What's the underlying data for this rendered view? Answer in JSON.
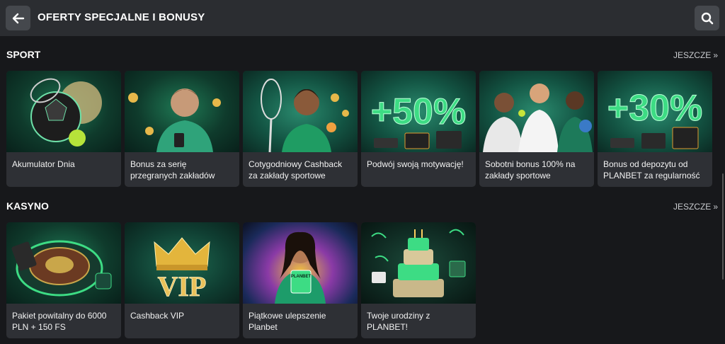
{
  "header": {
    "title": "OFERTY SPECJALNE I BONUSY"
  },
  "sections": {
    "sport": {
      "title": "SPORT",
      "more": "JESZCZE",
      "cards": [
        {
          "label": "Akumulator Dnia"
        },
        {
          "label": "Bonus za serię przegranych zakładów"
        },
        {
          "label": "Cotygodniowy Cashback za zakłady sportowe"
        },
        {
          "label": "Podwój swoją motywację!",
          "badge": "+50%"
        },
        {
          "label": "Sobotni bonus 100% na zakłady sportowe"
        },
        {
          "label": "Bonus od depozytu od PLANBET za regularność",
          "badge": "+30%"
        }
      ]
    },
    "casino": {
      "title": "KASYNO",
      "more": "JESZCZE",
      "cards": [
        {
          "label": "Pakiet powitalny do 6000 PLN + 150 FS"
        },
        {
          "label": "Cashback VIP",
          "badge": "VIP"
        },
        {
          "label": "Piątkowe ulepszenie Planbet",
          "badge": "PLANBET"
        },
        {
          "label": "Twoje urodziny z PLANBET!"
        }
      ]
    }
  },
  "colors": {
    "background": "#17181b",
    "topbar": "#2b2d31",
    "card": "#2e3035",
    "accent_green": "#3ddc84"
  }
}
